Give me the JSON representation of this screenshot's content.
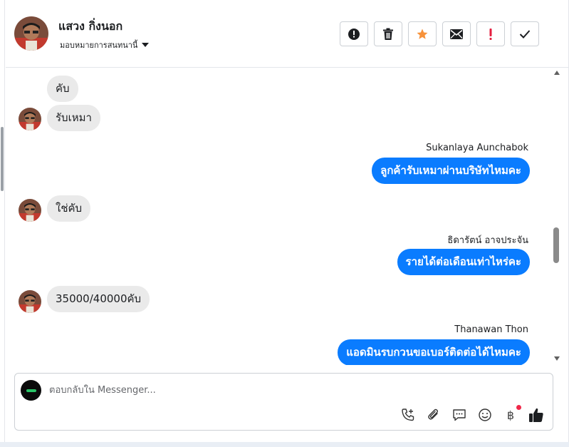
{
  "header": {
    "contact_name": "แสวง กิ่งนอก",
    "assign_label": "มอบหมายการสนทนานี้",
    "actions": [
      {
        "icon": "spam-alert-icon"
      },
      {
        "icon": "trash-icon"
      },
      {
        "icon": "star-icon",
        "color": "#f7923a"
      },
      {
        "icon": "mail-icon"
      },
      {
        "icon": "exclamation-icon",
        "color": "#e41e3f"
      },
      {
        "icon": "checkmark-icon"
      }
    ]
  },
  "conversation": {
    "messages": [
      {
        "direction": "in",
        "text": "คับ",
        "avatar": false
      },
      {
        "direction": "in",
        "text": "รับเหมา",
        "avatar": true
      },
      {
        "direction": "out",
        "sender": "Sukanlaya Aunchabok",
        "text": "ลูกค้ารับเหมาผ่านบริษัทไหมคะ"
      },
      {
        "direction": "in",
        "text": "ใช่คับ",
        "avatar": true
      },
      {
        "direction": "out",
        "sender": "ธิดารัตน์ อาจประจัน",
        "text": "รายได้ต่อเดือนเท่าไหร่คะ"
      },
      {
        "direction": "in",
        "text": "35000/40000คับ",
        "avatar": true
      },
      {
        "direction": "out",
        "sender": "Thanawan Thon",
        "text": "แอดมินรบกวนขอเบอร์ติดต่อได้ไหมคะ"
      }
    ]
  },
  "composer": {
    "placeholder": "ตอบกลับใน Messenger...",
    "value": "",
    "tools": [
      "call-add-icon",
      "paperclip-icon",
      "saved-reply-icon",
      "emoji-icon",
      "baht-payment-icon",
      "like-thumb-icon"
    ],
    "baht_symbol": "฿"
  },
  "colors": {
    "outgoing_bubble": "#0a7cff",
    "incoming_bubble": "#eaeaea",
    "accent_star": "#f7923a",
    "alert_red": "#e41e3f"
  }
}
